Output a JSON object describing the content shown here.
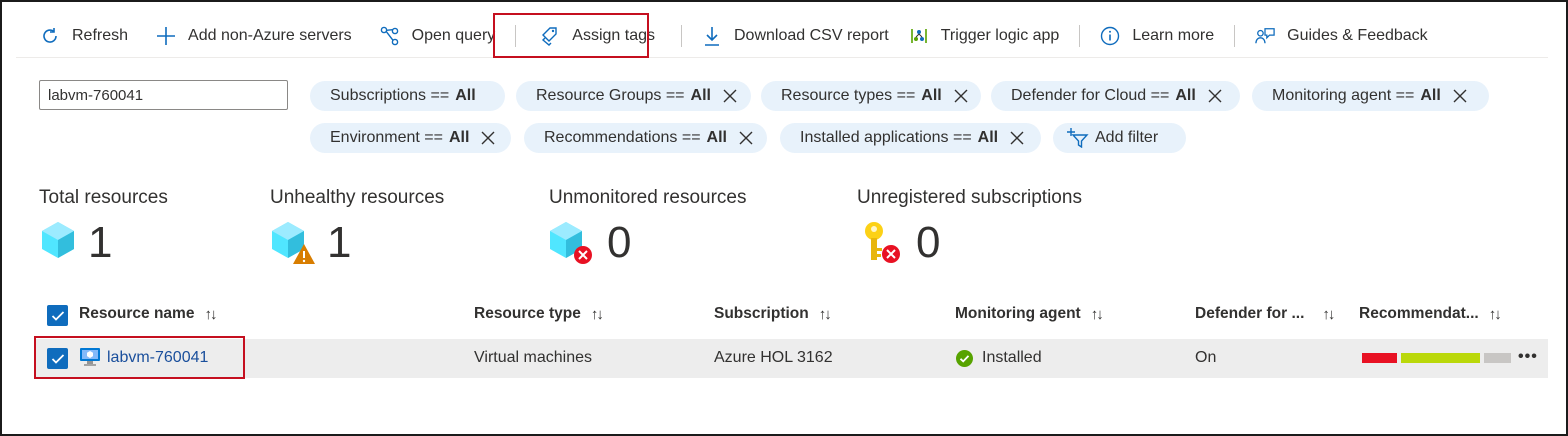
{
  "toolbar": {
    "refresh": "Refresh",
    "add_servers": "Add non-Azure servers",
    "open_query": "Open query",
    "assign_tags": "Assign tags",
    "download_csv": "Download CSV report",
    "trigger_logic": "Trigger logic app",
    "learn_more": "Learn more",
    "guides": "Guides & Feedback"
  },
  "search": {
    "value": "labvm-760041"
  },
  "filters": [
    {
      "label": "Subscriptions ==",
      "value": "All"
    },
    {
      "label": "Resource Groups ==",
      "value": "All"
    },
    {
      "label": "Resource types ==",
      "value": "All"
    },
    {
      "label": "Defender for Cloud ==",
      "value": "All"
    },
    {
      "label": "Monitoring agent ==",
      "value": "All"
    },
    {
      "label": "Environment ==",
      "value": "All"
    },
    {
      "label": "Recommendations ==",
      "value": "All"
    },
    {
      "label": "Installed applications ==",
      "value": "All"
    }
  ],
  "add_filter": "Add filter",
  "stats": {
    "total": {
      "title": "Total resources",
      "value": "1"
    },
    "unhealthy": {
      "title": "Unhealthy resources",
      "value": "1"
    },
    "unmonitored": {
      "title": "Unmonitored resources",
      "value": "0"
    },
    "unregistered": {
      "title": "Unregistered subscriptions",
      "value": "0"
    }
  },
  "table": {
    "columns": [
      "Resource name",
      "Resource type",
      "Subscription",
      "Monitoring agent",
      "Defender for ...",
      "Recommendat..."
    ],
    "sort_glyph": "↑↓",
    "rows": [
      {
        "name": "labvm-760041",
        "type": "Virtual machines",
        "subscription": "Azure HOL 3162",
        "agent": "Installed",
        "defender": "On",
        "recommendations": {
          "high": 0.25,
          "medium": 0.56,
          "low": 0.19
        }
      }
    ],
    "more": "•••"
  },
  "colors": {
    "accent": "#0f6cbd",
    "highlight": "#c50f1f",
    "rec_high": "#e81123",
    "rec_medium": "#bad80a",
    "rec_low": "#c8c6c4",
    "success": "#57a300"
  }
}
